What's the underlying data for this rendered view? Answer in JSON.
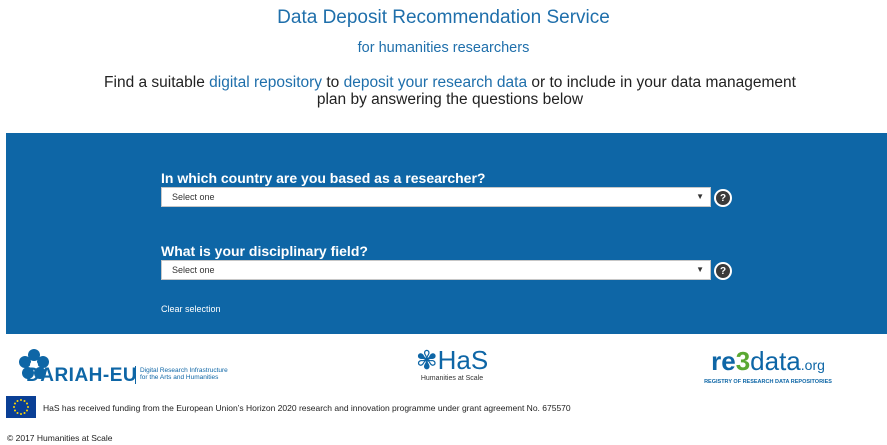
{
  "header": {
    "title": "Data Deposit Recommendation Service",
    "subtitle": "for humanities researchers"
  },
  "intro": {
    "part1": "Find a suitable ",
    "link1": "digital repository",
    "part2": " to ",
    "link2": "deposit your research data",
    "part3": " or to include in your data management plan by answering the questions below"
  },
  "form": {
    "q1": {
      "label": "In which country are you based as a researcher?",
      "selected": "Select one"
    },
    "q2": {
      "label": "What is your disciplinary field?",
      "selected": "Select one"
    },
    "help_glyph": "?",
    "clear_label": "Clear selection",
    "panel_color": "#0e66a6"
  },
  "footer": {
    "dariah": {
      "name": "DARIAH-EU",
      "tagline1": "Digital Research Infrastructure",
      "tagline2": "for the Arts and Humanities"
    },
    "has": {
      "name": "HaS",
      "tagline": "Humanities at Scale"
    },
    "re3": {
      "name_a": "re",
      "name_b": "3",
      "name_c": "data",
      "name_d": ".org",
      "tagline": "REGISTRY OF RESEARCH DATA REPOSITORIES"
    },
    "funding": "HaS has received funding from the European Union’s Horizon 2020 research and innovation programme under grant agreement No. 675570",
    "copyright": "© 2017 Humanities at Scale"
  }
}
